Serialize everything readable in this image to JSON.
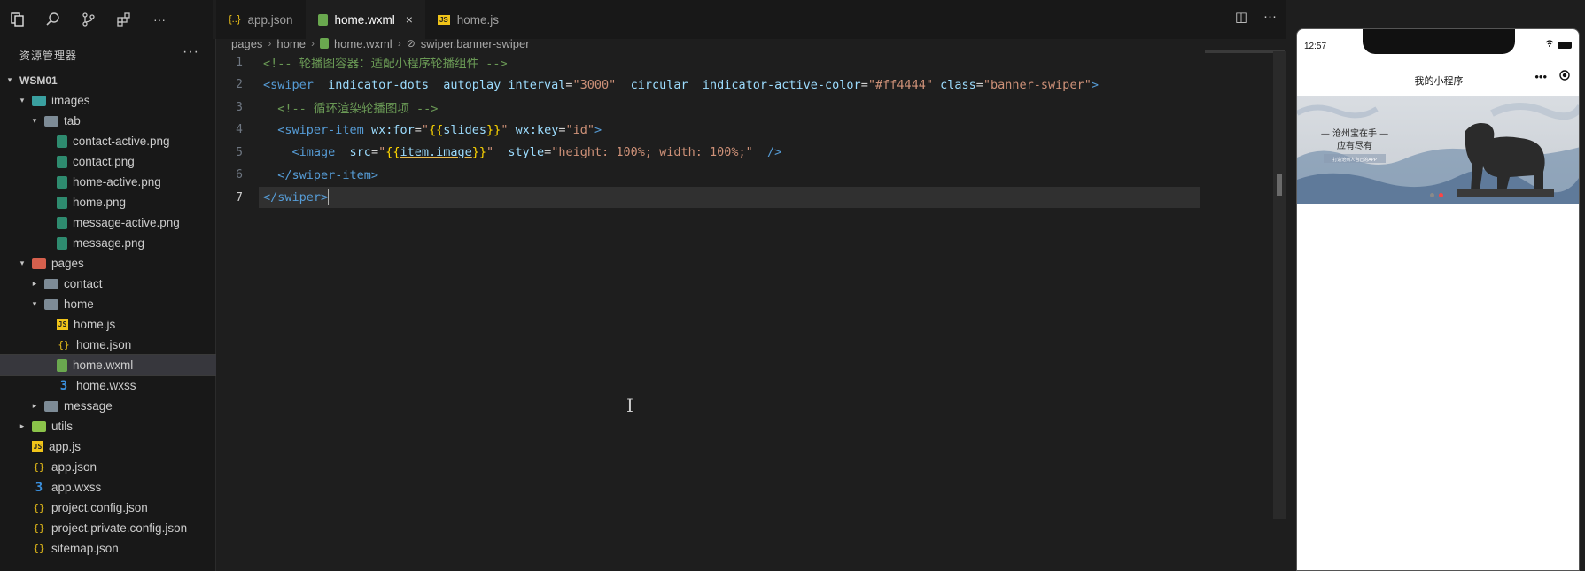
{
  "sidebar": {
    "title": "资源管理器",
    "more": "···",
    "tree": [
      {
        "label": "WSM01",
        "type": "root",
        "depth": 0,
        "arrow": "▾"
      },
      {
        "label": "images",
        "type": "folder-img",
        "depth": 1,
        "arrow": "▾"
      },
      {
        "label": "tab",
        "type": "folder",
        "depth": 2,
        "arrow": "▾"
      },
      {
        "label": "contact-active.png",
        "type": "png",
        "depth": 3
      },
      {
        "label": "contact.png",
        "type": "png",
        "depth": 3
      },
      {
        "label": "home-active.png",
        "type": "png",
        "depth": 3
      },
      {
        "label": "home.png",
        "type": "png",
        "depth": 3
      },
      {
        "label": "message-active.png",
        "type": "png",
        "depth": 3
      },
      {
        "label": "message.png",
        "type": "png",
        "depth": 3
      },
      {
        "label": "pages",
        "type": "folder-pages",
        "depth": 1,
        "arrow": "▾"
      },
      {
        "label": "contact",
        "type": "folder",
        "depth": 2,
        "arrow": "▸"
      },
      {
        "label": "home",
        "type": "folder",
        "depth": 2,
        "arrow": "▾"
      },
      {
        "label": "home.js",
        "type": "js",
        "depth": 3
      },
      {
        "label": "home.json",
        "type": "json",
        "depth": 3
      },
      {
        "label": "home.wxml",
        "type": "wxml",
        "depth": 3,
        "active": true
      },
      {
        "label": "home.wxss",
        "type": "wxss",
        "depth": 3
      },
      {
        "label": "message",
        "type": "folder",
        "depth": 2,
        "arrow": "▸"
      },
      {
        "label": "utils",
        "type": "folder-utils",
        "depth": 1,
        "arrow": "▸"
      },
      {
        "label": "app.js",
        "type": "js",
        "depth": 1
      },
      {
        "label": "app.json",
        "type": "json",
        "depth": 1
      },
      {
        "label": "app.wxss",
        "type": "wxss",
        "depth": 1
      },
      {
        "label": "project.config.json",
        "type": "json",
        "depth": 1
      },
      {
        "label": "project.private.config.json",
        "type": "json",
        "depth": 1
      },
      {
        "label": "sitemap.json",
        "type": "json",
        "depth": 1
      }
    ]
  },
  "tabs": [
    {
      "label": "app.json",
      "icon": "{..}",
      "active": false
    },
    {
      "label": "home.wxml",
      "icon": "wxml",
      "active": true,
      "close": "×"
    },
    {
      "label": "home.js",
      "icon": "JS",
      "active": false
    }
  ],
  "tab_actions": {
    "split": "◫",
    "more": "···"
  },
  "breadcrumb": {
    "items": [
      "pages",
      "home",
      "home.wxml",
      "swiper.banner-swiper"
    ],
    "sep": "›"
  },
  "editor": {
    "line_numbers": [
      "1",
      "2",
      "3",
      "4",
      "5",
      "6",
      "7"
    ],
    "current_line": 7,
    "lines": [
      [
        {
          "t": "<!-- 轮播图容器：适配小程序轮播组件 -->",
          "c": "comment"
        }
      ],
      [
        {
          "t": "<",
          "c": "tag"
        },
        {
          "t": "swiper",
          "c": "tag"
        },
        {
          "t": "  indicator-dots  autoplay ",
          "c": "attr"
        },
        {
          "t": "interval",
          "c": "attr"
        },
        {
          "t": "=",
          "c": "plain"
        },
        {
          "t": "\"3000\"",
          "c": "str"
        },
        {
          "t": "  circular  ",
          "c": "attr"
        },
        {
          "t": "indicator-active-color",
          "c": "attr"
        },
        {
          "t": "=",
          "c": "plain"
        },
        {
          "t": "\"#ff4444\"",
          "c": "str"
        },
        {
          "t": " class",
          "c": "attr"
        },
        {
          "t": "=",
          "c": "plain"
        },
        {
          "t": "\"banner-swiper\"",
          "c": "str"
        },
        {
          "t": ">",
          "c": "tag"
        }
      ],
      [
        {
          "t": "  ",
          "c": "plain"
        },
        {
          "t": "<!-- 循环渲染轮播图项 -->",
          "c": "comment"
        }
      ],
      [
        {
          "t": "  ",
          "c": "plain"
        },
        {
          "t": "<swiper-item",
          "c": "tag"
        },
        {
          "t": " wx:for",
          "c": "attr"
        },
        {
          "t": "=",
          "c": "plain"
        },
        {
          "t": "\"",
          "c": "str"
        },
        {
          "t": "{{",
          "c": "brace"
        },
        {
          "t": "slides",
          "c": "attr"
        },
        {
          "t": "}}",
          "c": "brace"
        },
        {
          "t": "\"",
          "c": "str"
        },
        {
          "t": " wx:key",
          "c": "attr"
        },
        {
          "t": "=",
          "c": "plain"
        },
        {
          "t": "\"id\"",
          "c": "str"
        },
        {
          "t": ">",
          "c": "tag"
        }
      ],
      [
        {
          "t": "    ",
          "c": "plain"
        },
        {
          "t": "<image",
          "c": "tag"
        },
        {
          "t": "  src",
          "c": "attr"
        },
        {
          "t": "=",
          "c": "plain"
        },
        {
          "t": "\"",
          "c": "str"
        },
        {
          "t": "{{",
          "c": "brace"
        },
        {
          "t": "item.image",
          "c": "var"
        },
        {
          "t": "}}",
          "c": "brace"
        },
        {
          "t": "\"",
          "c": "str"
        },
        {
          "t": "  style",
          "c": "attr"
        },
        {
          "t": "=",
          "c": "plain"
        },
        {
          "t": "\"height: 100%; width: 100%;\"",
          "c": "str"
        },
        {
          "t": "  />",
          "c": "tag"
        }
      ],
      [
        {
          "t": "  ",
          "c": "plain"
        },
        {
          "t": "</swiper-item>",
          "c": "tag"
        }
      ],
      [
        {
          "t": "</swiper>",
          "c": "tag"
        }
      ]
    ]
  },
  "simulator": {
    "time": "12:57",
    "title": "我的小程序",
    "menu": "•••",
    "banner_text_1": "— 沧州宝在手 —",
    "banner_text_2": "应有尽有",
    "banner_text_3": "打造沧州人自己的APP",
    "swiper": {
      "slide_count": 2,
      "active_index": 1,
      "active_color": "#ff4444"
    }
  }
}
